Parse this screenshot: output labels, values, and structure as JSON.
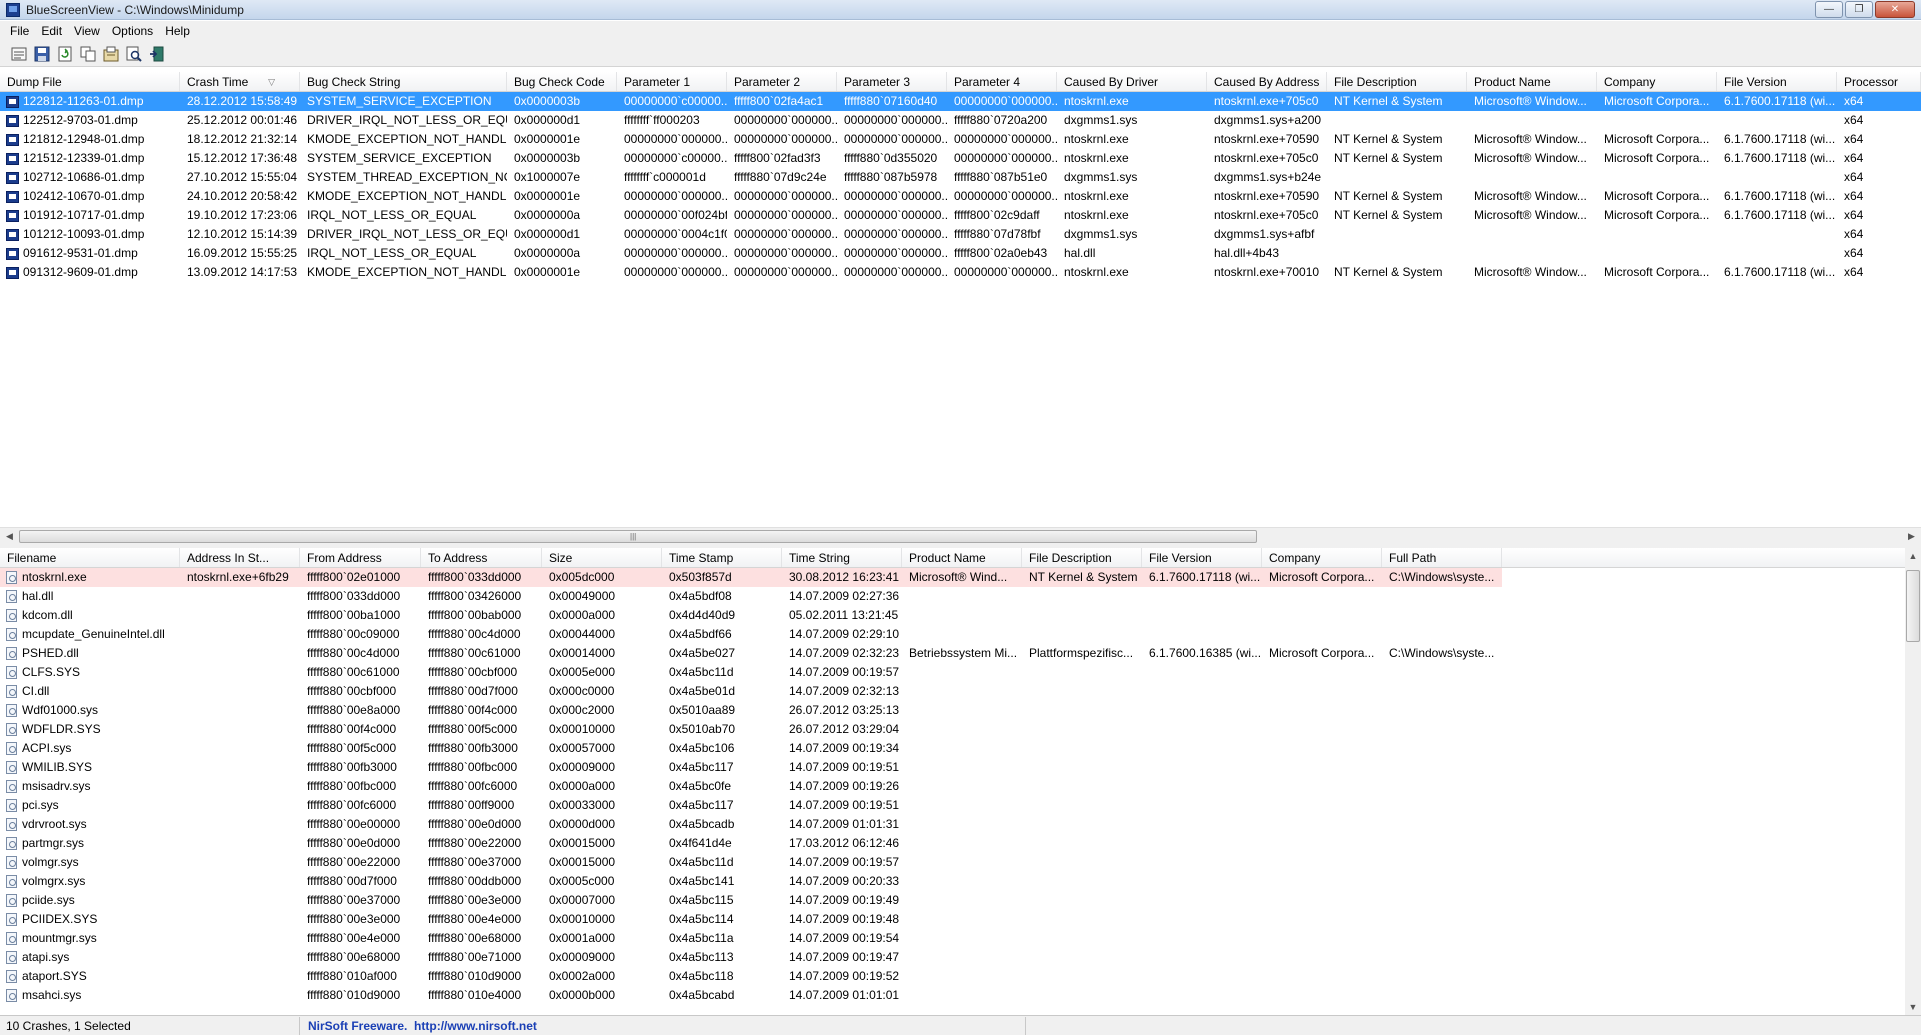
{
  "window": {
    "title": "BlueScreenView  -  C:\\Windows\\Minidump"
  },
  "menu": [
    "File",
    "Edit",
    "View",
    "Options",
    "Help"
  ],
  "toolbar": {
    "icons": [
      "save-list-icon",
      "save-selected-icon",
      "refresh-icon",
      "copy-icon",
      "properties-icon",
      "find-icon",
      "exit-icon"
    ]
  },
  "crash_list": {
    "columns": [
      "Dump File",
      "Crash Time",
      "Bug Check String",
      "Bug Check Code",
      "Parameter 1",
      "Parameter 2",
      "Parameter 3",
      "Parameter 4",
      "Caused By Driver",
      "Caused By Address",
      "File Description",
      "Product Name",
      "Company",
      "File Version",
      "Processor"
    ],
    "sorted_column": "Crash Time",
    "selected_index": 0,
    "rows": [
      [
        "122812-11263-01.dmp",
        "28.12.2012 15:58:49",
        "SYSTEM_SERVICE_EXCEPTION",
        "0x0000003b",
        "00000000`c00000...",
        "fffff800`02fa4ac1",
        "fffff880`07160d40",
        "00000000`000000...",
        "ntoskrnl.exe",
        "ntoskrnl.exe+705c0",
        "NT Kernel & System",
        "Microsoft® Window...",
        "Microsoft Corpora...",
        "6.1.7600.17118 (wi...",
        "x64"
      ],
      [
        "122512-9703-01.dmp",
        "25.12.2012 00:01:46",
        "DRIVER_IRQL_NOT_LESS_OR_EQUAL",
        "0x000000d1",
        "ffffffff`ff000203",
        "00000000`000000...",
        "00000000`000000...",
        "fffff880`0720a200",
        "dxgmms1.sys",
        "dxgmms1.sys+a200",
        "",
        "",
        "",
        "",
        "x64"
      ],
      [
        "121812-12948-01.dmp",
        "18.12.2012 21:32:14",
        "KMODE_EXCEPTION_NOT_HANDL...",
        "0x0000001e",
        "00000000`000000...",
        "00000000`000000...",
        "00000000`000000...",
        "00000000`000000...",
        "ntoskrnl.exe",
        "ntoskrnl.exe+70590",
        "NT Kernel & System",
        "Microsoft® Window...",
        "Microsoft Corpora...",
        "6.1.7600.17118 (wi...",
        "x64"
      ],
      [
        "121512-12339-01.dmp",
        "15.12.2012 17:36:48",
        "SYSTEM_SERVICE_EXCEPTION",
        "0x0000003b",
        "00000000`c00000...",
        "fffff800`02fad3f3",
        "fffff880`0d355020",
        "00000000`000000...",
        "ntoskrnl.exe",
        "ntoskrnl.exe+705c0",
        "NT Kernel & System",
        "Microsoft® Window...",
        "Microsoft Corpora...",
        "6.1.7600.17118 (wi...",
        "x64"
      ],
      [
        "102712-10686-01.dmp",
        "27.10.2012 15:55:04",
        "SYSTEM_THREAD_EXCEPTION_NO...",
        "0x1000007e",
        "ffffffff`c000001d",
        "fffff880`07d9c24e",
        "fffff880`087b5978",
        "fffff880`087b51e0",
        "dxgmms1.sys",
        "dxgmms1.sys+b24e",
        "",
        "",
        "",
        "",
        "x64"
      ],
      [
        "102412-10670-01.dmp",
        "24.10.2012 20:58:42",
        "KMODE_EXCEPTION_NOT_HANDL...",
        "0x0000001e",
        "00000000`000000...",
        "00000000`000000...",
        "00000000`000000...",
        "00000000`000000...",
        "ntoskrnl.exe",
        "ntoskrnl.exe+70590",
        "NT Kernel & System",
        "Microsoft® Window...",
        "Microsoft Corpora...",
        "6.1.7600.17118 (wi...",
        "x64"
      ],
      [
        "101912-10717-01.dmp",
        "19.10.2012 17:23:06",
        "IRQL_NOT_LESS_OR_EQUAL",
        "0x0000000a",
        "00000000`00f024bf",
        "00000000`000000...",
        "00000000`000000...",
        "fffff800`02c9daff",
        "ntoskrnl.exe",
        "ntoskrnl.exe+705c0",
        "NT Kernel & System",
        "Microsoft® Window...",
        "Microsoft Corpora...",
        "6.1.7600.17118 (wi...",
        "x64"
      ],
      [
        "101212-10093-01.dmp",
        "12.10.2012 15:14:39",
        "DRIVER_IRQL_NOT_LESS_OR_EQUAL",
        "0x000000d1",
        "00000000`0004c1f0",
        "00000000`000000...",
        "00000000`000000...",
        "fffff880`07d78fbf",
        "dxgmms1.sys",
        "dxgmms1.sys+afbf",
        "",
        "",
        "",
        "",
        "x64"
      ],
      [
        "091612-9531-01.dmp",
        "16.09.2012 15:55:25",
        "IRQL_NOT_LESS_OR_EQUAL",
        "0x0000000a",
        "00000000`000000...",
        "00000000`000000...",
        "00000000`000000...",
        "fffff800`02a0eb43",
        "hal.dll",
        "hal.dll+4b43",
        "",
        "",
        "",
        "",
        "x64"
      ],
      [
        "091312-9609-01.dmp",
        "13.09.2012 14:17:53",
        "KMODE_EXCEPTION_NOT_HANDL...",
        "0x0000001e",
        "00000000`000000...",
        "00000000`000000...",
        "00000000`000000...",
        "00000000`000000...",
        "ntoskrnl.exe",
        "ntoskrnl.exe+70010",
        "NT Kernel & System",
        "Microsoft® Window...",
        "Microsoft Corpora...",
        "6.1.7600.17118 (wi...",
        "x64"
      ]
    ]
  },
  "driver_list": {
    "columns": [
      "Filename",
      "Address In St...",
      "From Address",
      "To Address",
      "Size",
      "Time Stamp",
      "Time String",
      "Product Name",
      "File Description",
      "File Version",
      "Company",
      "Full Path"
    ],
    "highlighted_index": 0,
    "rows": [
      [
        "ntoskrnl.exe",
        "ntoskrnl.exe+6fb29",
        "fffff800`02e01000",
        "fffff800`033dd000",
        "0x005dc000",
        "0x503f857d",
        "30.08.2012 16:23:41",
        "Microsoft® Wind...",
        "NT Kernel & System",
        "6.1.7600.17118 (wi...",
        "Microsoft Corpora...",
        "C:\\Windows\\syste..."
      ],
      [
        "hal.dll",
        "",
        "fffff800`033dd000",
        "fffff800`03426000",
        "0x00049000",
        "0x4a5bdf08",
        "14.07.2009 02:27:36",
        "",
        "",
        "",
        "",
        ""
      ],
      [
        "kdcom.dll",
        "",
        "fffff800`00ba1000",
        "fffff800`00bab000",
        "0x0000a000",
        "0x4d4d40d9",
        "05.02.2011 13:21:45",
        "",
        "",
        "",
        "",
        ""
      ],
      [
        "mcupdate_GenuineIntel.dll",
        "",
        "fffff880`00c09000",
        "fffff880`00c4d000",
        "0x00044000",
        "0x4a5bdf66",
        "14.07.2009 02:29:10",
        "",
        "",
        "",
        "",
        ""
      ],
      [
        "PSHED.dll",
        "",
        "fffff880`00c4d000",
        "fffff880`00c61000",
        "0x00014000",
        "0x4a5be027",
        "14.07.2009 02:32:23",
        "Betriebssystem Mi...",
        "Plattformspezifisc...",
        "6.1.7600.16385 (wi...",
        "Microsoft Corpora...",
        "C:\\Windows\\syste..."
      ],
      [
        "CLFS.SYS",
        "",
        "fffff880`00c61000",
        "fffff880`00cbf000",
        "0x0005e000",
        "0x4a5bc11d",
        "14.07.2009 00:19:57",
        "",
        "",
        "",
        "",
        ""
      ],
      [
        "CI.dll",
        "",
        "fffff880`00cbf000",
        "fffff880`00d7f000",
        "0x000c0000",
        "0x4a5be01d",
        "14.07.2009 02:32:13",
        "",
        "",
        "",
        "",
        ""
      ],
      [
        "Wdf01000.sys",
        "",
        "fffff880`00e8a000",
        "fffff880`00f4c000",
        "0x000c2000",
        "0x5010aa89",
        "26.07.2012 03:25:13",
        "",
        "",
        "",
        "",
        ""
      ],
      [
        "WDFLDR.SYS",
        "",
        "fffff880`00f4c000",
        "fffff880`00f5c000",
        "0x00010000",
        "0x5010ab70",
        "26.07.2012 03:29:04",
        "",
        "",
        "",
        "",
        ""
      ],
      [
        "ACPI.sys",
        "",
        "fffff880`00f5c000",
        "fffff880`00fb3000",
        "0x00057000",
        "0x4a5bc106",
        "14.07.2009 00:19:34",
        "",
        "",
        "",
        "",
        ""
      ],
      [
        "WMILIB.SYS",
        "",
        "fffff880`00fb3000",
        "fffff880`00fbc000",
        "0x00009000",
        "0x4a5bc117",
        "14.07.2009 00:19:51",
        "",
        "",
        "",
        "",
        ""
      ],
      [
        "msisadrv.sys",
        "",
        "fffff880`00fbc000",
        "fffff880`00fc6000",
        "0x0000a000",
        "0x4a5bc0fe",
        "14.07.2009 00:19:26",
        "",
        "",
        "",
        "",
        ""
      ],
      [
        "pci.sys",
        "",
        "fffff880`00fc6000",
        "fffff880`00ff9000",
        "0x00033000",
        "0x4a5bc117",
        "14.07.2009 00:19:51",
        "",
        "",
        "",
        "",
        ""
      ],
      [
        "vdrvroot.sys",
        "",
        "fffff880`00e00000",
        "fffff880`00e0d000",
        "0x0000d000",
        "0x4a5bcadb",
        "14.07.2009 01:01:31",
        "",
        "",
        "",
        "",
        ""
      ],
      [
        "partmgr.sys",
        "",
        "fffff880`00e0d000",
        "fffff880`00e22000",
        "0x00015000",
        "0x4f641d4e",
        "17.03.2012 06:12:46",
        "",
        "",
        "",
        "",
        ""
      ],
      [
        "volmgr.sys",
        "",
        "fffff880`00e22000",
        "fffff880`00e37000",
        "0x00015000",
        "0x4a5bc11d",
        "14.07.2009 00:19:57",
        "",
        "",
        "",
        "",
        ""
      ],
      [
        "volmgrx.sys",
        "",
        "fffff880`00d7f000",
        "fffff880`00ddb000",
        "0x0005c000",
        "0x4a5bc141",
        "14.07.2009 00:20:33",
        "",
        "",
        "",
        "",
        ""
      ],
      [
        "pciide.sys",
        "",
        "fffff880`00e37000",
        "fffff880`00e3e000",
        "0x00007000",
        "0x4a5bc115",
        "14.07.2009 00:19:49",
        "",
        "",
        "",
        "",
        ""
      ],
      [
        "PCIIDEX.SYS",
        "",
        "fffff880`00e3e000",
        "fffff880`00e4e000",
        "0x00010000",
        "0x4a5bc114",
        "14.07.2009 00:19:48",
        "",
        "",
        "",
        "",
        ""
      ],
      [
        "mountmgr.sys",
        "",
        "fffff880`00e4e000",
        "fffff880`00e68000",
        "0x0001a000",
        "0x4a5bc11a",
        "14.07.2009 00:19:54",
        "",
        "",
        "",
        "",
        ""
      ],
      [
        "atapi.sys",
        "",
        "fffff880`00e68000",
        "fffff880`00e71000",
        "0x00009000",
        "0x4a5bc113",
        "14.07.2009 00:19:47",
        "",
        "",
        "",
        "",
        ""
      ],
      [
        "ataport.SYS",
        "",
        "fffff880`010af000",
        "fffff880`010d9000",
        "0x0002a000",
        "0x4a5bc118",
        "14.07.2009 00:19:52",
        "",
        "",
        "",
        "",
        ""
      ],
      [
        "msahci.sys",
        "",
        "fffff880`010d9000",
        "fffff880`010e4000",
        "0x0000b000",
        "0x4a5bcabd",
        "14.07.2009 01:01:01",
        "",
        "",
        "",
        "",
        ""
      ]
    ]
  },
  "status": {
    "count": "10 Crashes, 1 Selected",
    "freeware": "NirSoft Freeware.",
    "url": "http://www.nirsoft.net"
  },
  "colors": {
    "selection": "#3399ff",
    "highlight": "#fde0e0",
    "link": "#1a3fb5"
  }
}
